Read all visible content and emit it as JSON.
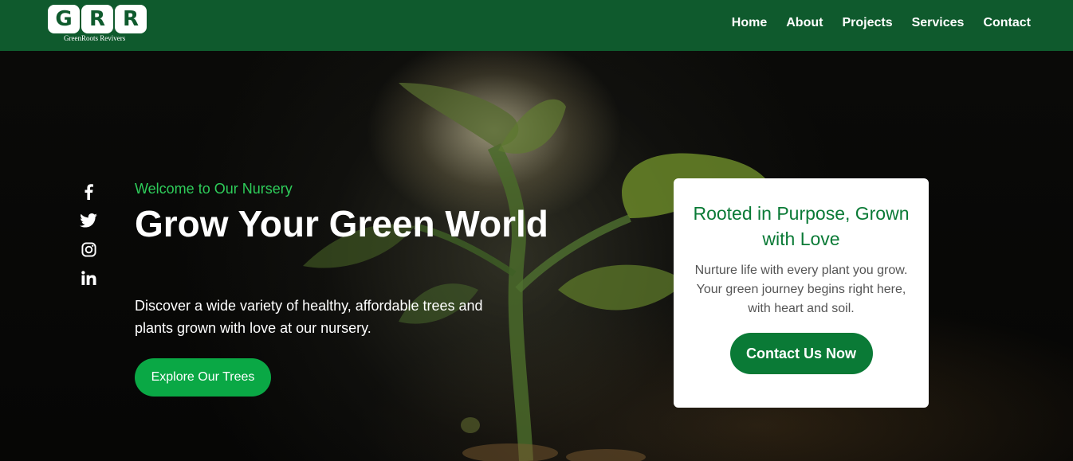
{
  "header": {
    "logo_letters": [
      "G",
      "R",
      "R"
    ],
    "logo_subtitle": "GreenRoots Revivers",
    "nav": [
      "Home",
      "About",
      "Projects",
      "Services",
      "Contact"
    ]
  },
  "social": [
    "facebook-icon",
    "twitter-icon",
    "instagram-icon",
    "linkedin-icon"
  ],
  "hero": {
    "eyebrow": "Welcome to Our Nursery",
    "title": "Grow Your Green World",
    "description": "Discover a wide variety of healthy, affordable trees and plants grown with love at our nursery.",
    "cta": "Explore Our Trees"
  },
  "card": {
    "title": "Rooted in Purpose, Grown with Love",
    "text": "Nurture life with every plant you grow. Your green journey begins right here, with heart and soil.",
    "button": "Contact Us Now"
  },
  "colors": {
    "header_bg": "#0f5a2d",
    "accent_green": "#2ecc5a",
    "cta_green": "#0aa845",
    "card_green": "#0a7a36"
  }
}
